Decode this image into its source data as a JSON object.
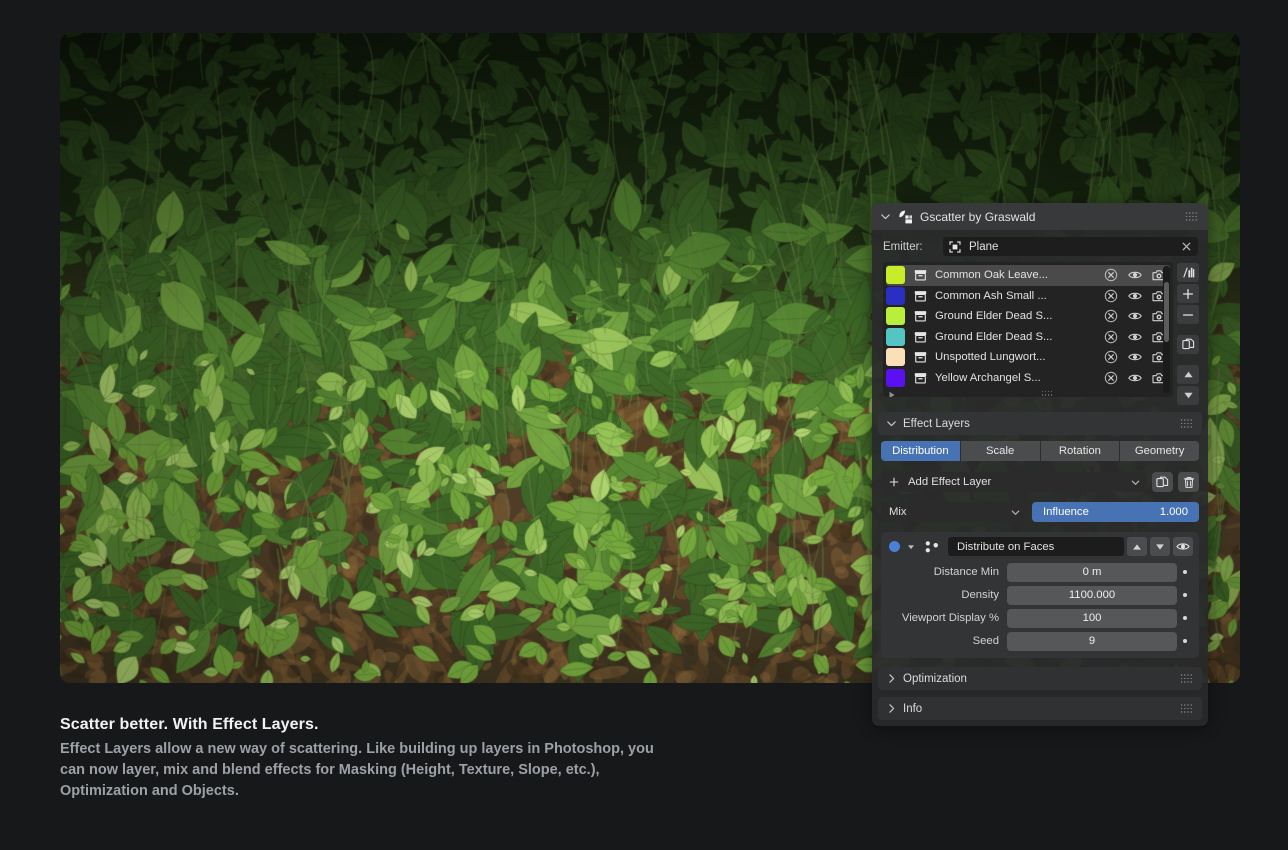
{
  "hero": {
    "alt": "forest-floor-vegetation-render",
    "description": "3D render of dense forest floor with green leaves, ferns and brown leaf litter"
  },
  "caption": {
    "title": "Scatter better. With Effect Layers.",
    "body": "Effect Layers allow a new way of scattering. Like building up layers in Photoshop, you can now layer, mix and blend effects for Masking (Height, Texture, Slope, etc.), Optimization and Objects."
  },
  "panel": {
    "title": "Gscatter by Graswald",
    "emitter": {
      "label": "Emitter:",
      "value": "Plane",
      "clear_label": "✕"
    },
    "scatter_items": [
      {
        "name": "Common Oak Leave...",
        "color": "#c8ec2a",
        "selected": true
      },
      {
        "name": "Common Ash Small ...",
        "color": "#2a2ec2",
        "selected": false
      },
      {
        "name": "Ground Elder Dead S...",
        "color": "#b9ef3c",
        "selected": false
      },
      {
        "name": "Ground Elder Dead S...",
        "color": "#54c5c2",
        "selected": false
      },
      {
        "name": "Unspotted Lungwort...",
        "color": "#fadfb8",
        "selected": false
      },
      {
        "name": "Yellow Archangel S...",
        "color": "#5a10f0",
        "selected": false
      }
    ],
    "row_icons": {
      "remove": "x-circle-icon",
      "visibility": "eye-icon",
      "render": "camera-icon"
    },
    "side_tools": [
      "histogram-icon",
      "plus-icon",
      "minus-icon",
      "duplicate-icon",
      "move-up-icon",
      "move-down-icon"
    ],
    "effect_layers": {
      "section_title": "Effect Layers",
      "tabs": [
        {
          "label": "Distribution",
          "active": true
        },
        {
          "label": "Scale",
          "active": false
        },
        {
          "label": "Rotation",
          "active": false
        },
        {
          "label": "Geometry",
          "active": false
        }
      ],
      "add_layer_label": "Add Effect Layer",
      "copy_icon": "duplicate-icon",
      "delete_icon": "trash-icon",
      "blend_mode": "Mix",
      "influence_label": "Influence",
      "influence_value": "1.000",
      "layer": {
        "name": "Distribute on Faces",
        "move_up_icon": "triangle-up-icon",
        "move_down_icon": "triangle-down-icon",
        "visibility_icon": "eye-icon",
        "properties": [
          {
            "label": "Distance Min",
            "value": "0 m"
          },
          {
            "label": "Density",
            "value": "1100.000"
          },
          {
            "label": "Viewport Display %",
            "value": "100"
          },
          {
            "label": "Seed",
            "value": "9"
          }
        ]
      }
    },
    "collapsed_sections": [
      {
        "label": "Optimization"
      },
      {
        "label": "Info"
      }
    ],
    "accent_color": "#4772b3",
    "panel_bg": "#28292b"
  }
}
